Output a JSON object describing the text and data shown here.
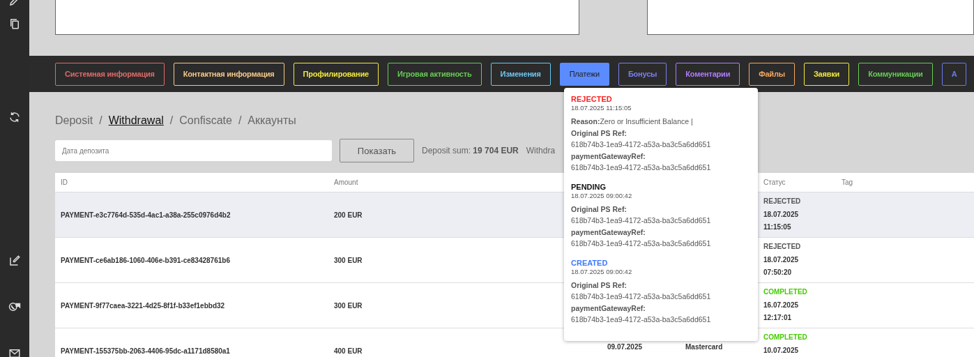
{
  "tabs": [
    {
      "label": "Системная информация",
      "color": "#e06a6a",
      "selected": false
    },
    {
      "label": "Контактная информация",
      "color": "#f7c98a",
      "selected": false
    },
    {
      "label": "Профилирование",
      "color": "#f2ea3c",
      "selected": false
    },
    {
      "label": "Игровая активность",
      "color": "#66cc55",
      "selected": false
    },
    {
      "label": "Изменения",
      "color": "#6cc8f0",
      "selected": false
    },
    {
      "label": "Платежи",
      "color": "#5b8cff",
      "selected": true
    },
    {
      "label": "Бонусы",
      "color": "#7a7ef0",
      "selected": false
    },
    {
      "label": "Коментарии",
      "color": "#b07cff",
      "selected": false
    },
    {
      "label": "Файлы",
      "color": "#f5a860",
      "selected": false
    },
    {
      "label": "Заявки",
      "color": "#f2ea3c",
      "selected": false
    },
    {
      "label": "Коммуникации",
      "color": "#66cc55",
      "selected": false
    },
    {
      "label": "А",
      "color": "#6a7af0",
      "selected": false
    }
  ],
  "breadcrumbs": [
    {
      "label": "Deposit",
      "selected": false
    },
    {
      "label": "Withdrawal",
      "selected": true
    },
    {
      "label": "Confiscate",
      "selected": false
    },
    {
      "label": "Аккаунты",
      "selected": false
    }
  ],
  "breadcrumb_separator": "/",
  "filter": {
    "placeholder": "Дата депозита",
    "button": "Показать",
    "summary": "Deposit sum: **19 704 EUR**",
    "summary_2": "Withdra"
  },
  "table": {
    "columns": [
      "ID",
      "Amount",
      "Статус",
      "Tag"
    ],
    "rows": [
      {
        "id": "PAYMENT-e3c7764d-535d-4ac1-a38a-255c0976d4b2",
        "amount": "200 EUR",
        "status": "REJECTED",
        "color": "#555555",
        "date": "18.07.2025",
        "time": "11:15:05",
        "hovered": true
      },
      {
        "id": "PAYMENT-ce6ab186-1060-406e-b391-ce83428761b6",
        "amount": "300 EUR",
        "status": "REJECTED",
        "color": "#555555",
        "date": "18.07.2025",
        "time": "07:50:20",
        "hovered": false
      },
      {
        "id": "PAYMENT-9f77caea-3221-4d25-8f1f-b33ef1ebbd32",
        "amount": "300 EUR",
        "status": "COMPLETED",
        "color": "#44cc00",
        "date": "16.07.2025",
        "time": "12:17:01",
        "hovered": false
      },
      {
        "id": "PAYMENT-155375bb-2063-4406-95dc-a1171d8580a1",
        "amount": "400 EUR",
        "column_3": "09.07.2025",
        "column_4": "Mastercard",
        "status": "COMPLETED",
        "color": "#44cc00",
        "date": "10.07.2025",
        "hovered": false
      }
    ]
  },
  "popover": {
    "entries": [
      {
        "status": "REJECTED",
        "color": "#ff2020",
        "datetime": "18.07.2025 11:15:05",
        "fields": [
          {
            "kind": "inline",
            "label": "Reason:",
            "value": "Zero or Insufficient Balance |"
          },
          {
            "kind": "block",
            "label": "Original PS Ref:",
            "value": "618b74b3-1ea9-4172-a53a-ba3c5a6dd651"
          },
          {
            "kind": "block",
            "label": "paymentGatewayRef:",
            "value": "618b74b3-1ea9-4172-a53a-ba3c5a6dd651"
          }
        ]
      },
      {
        "status": "PENDING",
        "color": "#111111",
        "datetime": "18.07.2025 09:00:42",
        "fields": [
          {
            "kind": "block",
            "label": "Original PS Ref:",
            "value": "618b74b3-1ea9-4172-a53a-ba3c5a6dd651"
          },
          {
            "kind": "block",
            "label": "paymentGatewayRef:",
            "value": "618b74b3-1ea9-4172-a53a-ba3c5a6dd651"
          }
        ]
      },
      {
        "status": "CREATED",
        "color": "#3a7aff",
        "datetime": "18.07.2025 09:00:42",
        "fields": [
          {
            "kind": "block",
            "label": "Original PS Ref:",
            "value": "618b74b3-1ea9-4172-a53a-ba3c5a6dd651"
          },
          {
            "kind": "block",
            "label": "paymentGatewayRef:",
            "value": "618b74b3-1ea9-4172-a53a-ba3c5a6dd651"
          }
        ]
      }
    ]
  }
}
